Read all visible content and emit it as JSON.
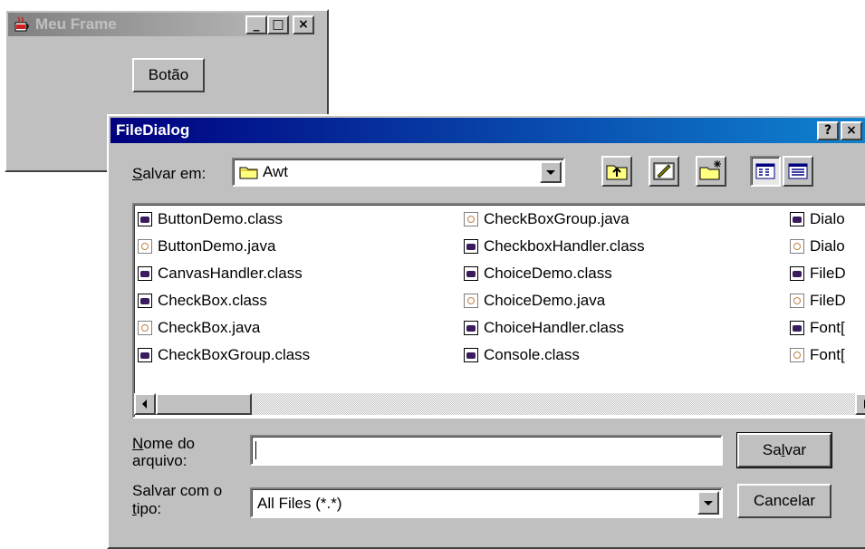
{
  "meu_frame": {
    "title": "Meu Frame",
    "button_label": "Botão",
    "caption_buttons": [
      "_",
      "□",
      "×"
    ]
  },
  "file_dialog": {
    "title": "FileDialog",
    "help_label": "?",
    "close_label": "×",
    "save_in": {
      "label_prefix": "S",
      "label_rest": "alvar em:",
      "value": "Awt"
    },
    "files": [
      {
        "name": "ButtonDemo.class",
        "type": "class"
      },
      {
        "name": "ButtonDemo.java",
        "type": "java"
      },
      {
        "name": "CanvasHandler.class",
        "type": "class"
      },
      {
        "name": "CheckBox.class",
        "type": "class"
      },
      {
        "name": "CheckBox.java",
        "type": "java"
      },
      {
        "name": "CheckBoxGroup.class",
        "type": "class"
      },
      {
        "name": "CheckBoxGroup.java",
        "type": "java"
      },
      {
        "name": "CheckboxHandler.class",
        "type": "class"
      },
      {
        "name": "ChoiceDemo.class",
        "type": "class"
      },
      {
        "name": "ChoiceDemo.java",
        "type": "java"
      },
      {
        "name": "ChoiceHandler.class",
        "type": "class"
      },
      {
        "name": "Console.class",
        "type": "class"
      },
      {
        "name": "Dialo",
        "type": "class"
      },
      {
        "name": "Dialo",
        "type": "java"
      },
      {
        "name": "FileD",
        "type": "class"
      },
      {
        "name": "FileD",
        "type": "java"
      },
      {
        "name": "Font[",
        "type": "class"
      },
      {
        "name": "Font[",
        "type": "java"
      }
    ],
    "filename": {
      "label_prefix": "N",
      "label_rest": "ome do",
      "label_line2": "arquivo:",
      "value": ""
    },
    "filetype": {
      "label_line1": "Salvar com o",
      "label_prefix": "t",
      "label_rest": "ipo:",
      "value": "All Files (*.*)"
    },
    "save_button": {
      "prefix": "Sa",
      "accel": "l",
      "rest": "var"
    },
    "cancel_button": "Cancelar",
    "colors": {
      "titlebar_start": "#000080",
      "titlebar_end": "#1084d0",
      "inactive_title": "#808080",
      "face": "#c0c0c0"
    }
  }
}
